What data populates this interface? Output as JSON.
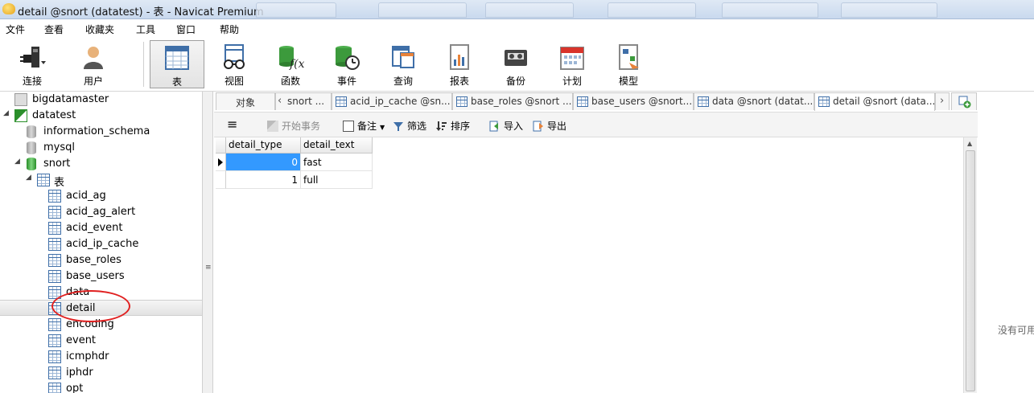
{
  "window": {
    "title": "detail @snort (datatest) - 表 - Navicat Premium"
  },
  "menu": [
    "文件",
    "查看",
    "收藏夹",
    "工具",
    "窗口",
    "帮助"
  ],
  "toolbar": {
    "connect": "连接",
    "user": "用户",
    "table": "表",
    "view": "视图",
    "function": "函数",
    "event": "事件",
    "query": "查询",
    "report": "报表",
    "backup": "备份",
    "schedule": "计划",
    "model": "模型"
  },
  "tree": {
    "items": [
      {
        "label": "bigdatamaster"
      },
      {
        "label": "datatest"
      },
      {
        "label": "information_schema"
      },
      {
        "label": "mysql"
      },
      {
        "label": "snort"
      },
      {
        "label": "表"
      },
      {
        "label": "acid_ag"
      },
      {
        "label": "acid_ag_alert"
      },
      {
        "label": "acid_event"
      },
      {
        "label": "acid_ip_cache"
      },
      {
        "label": "base_roles"
      },
      {
        "label": "base_users"
      },
      {
        "label": "data"
      },
      {
        "label": "detail"
      },
      {
        "label": "encoding"
      },
      {
        "label": "event"
      },
      {
        "label": "icmphdr"
      },
      {
        "label": "iphdr"
      },
      {
        "label": "opt"
      }
    ]
  },
  "tabs": {
    "objects": "对象",
    "items": [
      {
        "label": "snort ..."
      },
      {
        "label": "acid_ip_cache @sn..."
      },
      {
        "label": "base_roles @snort ..."
      },
      {
        "label": "base_users @snort..."
      },
      {
        "label": "data @snort (datat..."
      },
      {
        "label": "detail @snort (data..."
      }
    ]
  },
  "gridbar": {
    "begin_transaction": "开始事务",
    "memo": "备注",
    "filter": "筛选",
    "sort": "排序",
    "import": "导入",
    "export": "导出"
  },
  "grid": {
    "columns": [
      "detail_type",
      "detail_text"
    ],
    "rows": [
      {
        "detail_type": "0",
        "detail_text": "fast"
      },
      {
        "detail_type": "1",
        "detail_text": "full"
      }
    ]
  },
  "side_text": "没有可用"
}
